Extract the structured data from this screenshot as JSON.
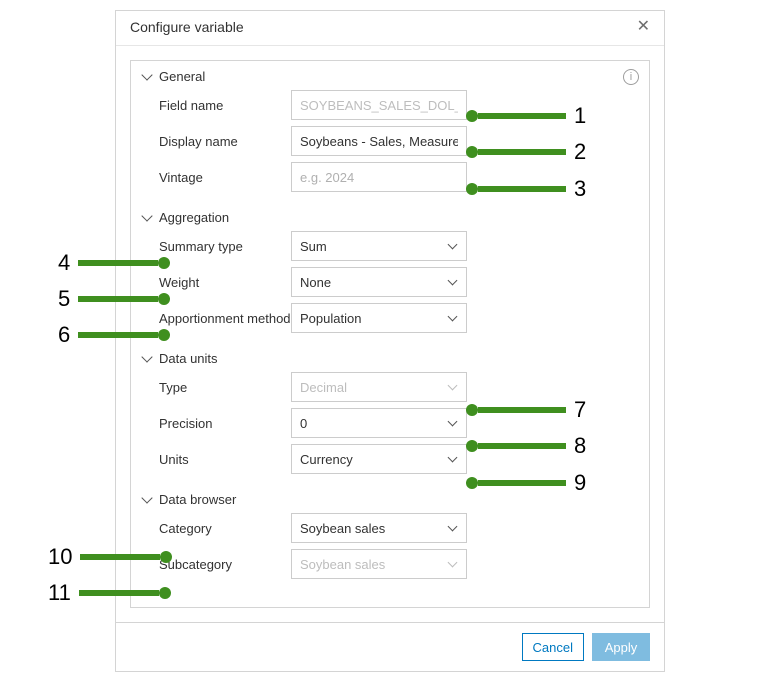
{
  "dialog": {
    "title": "Configure variable",
    "close_icon": "close-icon",
    "info_icon": "info-icon"
  },
  "sections": {
    "general": {
      "title": "General",
      "field_name": {
        "label": "Field name",
        "value": "SOYBEANS_SALES_DOL_TOT"
      },
      "display_name": {
        "label": "Display name",
        "value": "Soybeans - Sales, Measured In"
      },
      "vintage": {
        "label": "Vintage",
        "placeholder": "e.g. 2024",
        "value": ""
      }
    },
    "aggregation": {
      "title": "Aggregation",
      "summary_type": {
        "label": "Summary type",
        "value": "Sum"
      },
      "weight": {
        "label": "Weight",
        "value": "None"
      },
      "apportionment": {
        "label": "Apportionment method",
        "value": "Population"
      }
    },
    "data_units": {
      "title": "Data units",
      "type": {
        "label": "Type",
        "value": "Decimal"
      },
      "precision": {
        "label": "Precision",
        "value": "0"
      },
      "units": {
        "label": "Units",
        "value": "Currency"
      }
    },
    "data_browser": {
      "title": "Data browser",
      "category": {
        "label": "Category",
        "value": "Soybean sales"
      },
      "subcategory": {
        "label": "Subcategory",
        "value": "Soybean sales"
      }
    }
  },
  "footer": {
    "cancel": "Cancel",
    "apply": "Apply"
  },
  "annotations": {
    "n1": "1",
    "n2": "2",
    "n3": "3",
    "n4": "4",
    "n5": "5",
    "n6": "6",
    "n7": "7",
    "n8": "8",
    "n9": "9",
    "n10": "10",
    "n11": "11"
  }
}
